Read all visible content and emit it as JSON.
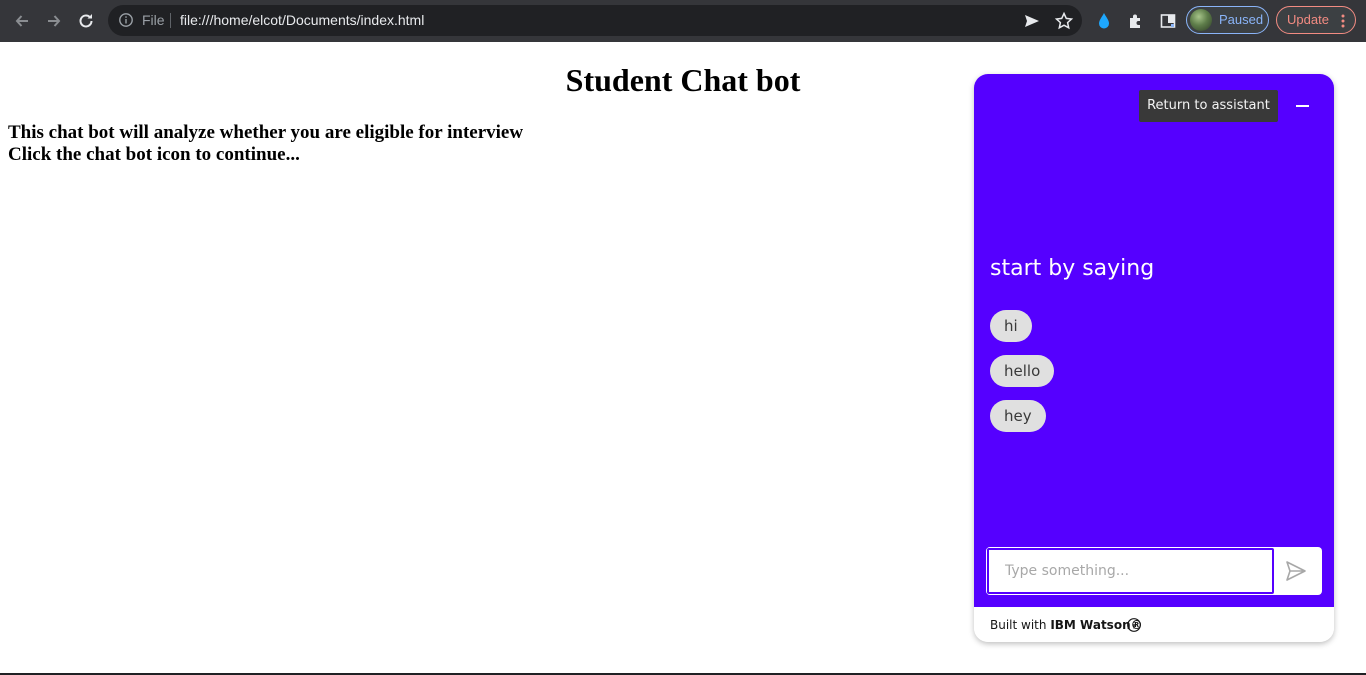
{
  "browser": {
    "scheme_label": "File",
    "url": "file:///home/elcot/Documents/index.html",
    "profile_label": "Paused",
    "update_label": "Update"
  },
  "page": {
    "title": "Student Chat bot",
    "lines": [
      "This chat bot will analyze whether you are eligible for interview",
      "Click the chat bot icon to continue..."
    ]
  },
  "chat": {
    "tooltip": "Return to assistant",
    "prompt_title": "start by saying",
    "options": [
      "hi",
      "hello",
      "hey"
    ],
    "input_placeholder": "Type something...",
    "footer_prefix": "Built with",
    "footer_brand": "IBM Watson®",
    "colors": {
      "background": "#5500ff",
      "option_bg": "#e0e0e0"
    }
  }
}
